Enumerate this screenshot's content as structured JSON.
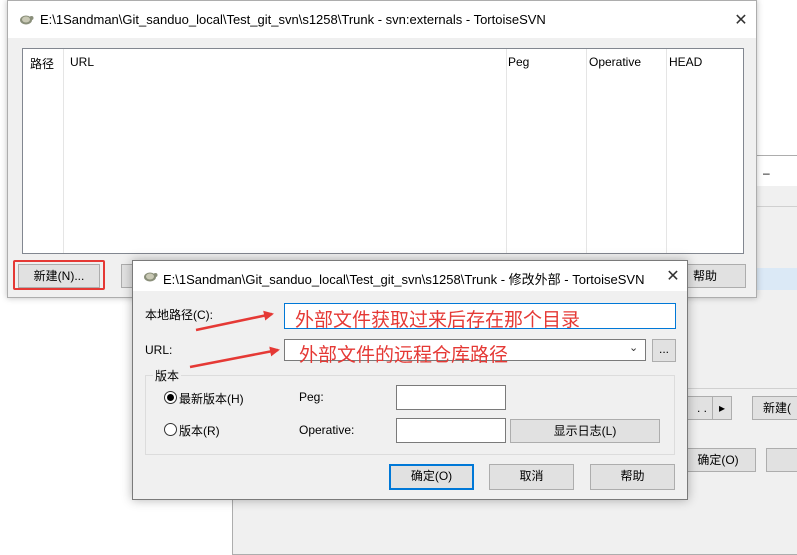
{
  "main_window": {
    "title": "E:\\1Sandman\\Git_sanduo_local\\Test_git_svn\\s1258\\Trunk - svn:externals - TortoiseSVN",
    "columns": [
      "路径",
      "URL",
      "Peg",
      "Operative",
      "HEAD"
    ],
    "buttons": {
      "new": "新建(N)...",
      "help": "帮助"
    }
  },
  "background_window": {
    "title_fragment": "–",
    "buttons": {
      "dots": ". .",
      "next": "▸",
      "new": "新建(",
      "ok": "确定(O)"
    }
  },
  "dialog": {
    "title": "E:\\1Sandman\\Git_sanduo_local\\Test_git_svn\\s1258\\Trunk - 修改外部 - TortoiseSVN",
    "local_path_label": "本地路径(C):",
    "local_path_value": "",
    "url_label": "URL:",
    "url_value": "",
    "browse_button": "...",
    "revision_group": "版本",
    "latest_revision_label": "最新版本(H)",
    "revision_label": "版本(R)",
    "peg_label": "Peg:",
    "peg_value": "",
    "operative_label": "Operative:",
    "operative_value": "",
    "show_log_button": "显示日志(L)",
    "ok_button": "确定(O)",
    "cancel_button": "取消",
    "help_button": "帮助",
    "selected_revision": "latest"
  },
  "annotations": {
    "local_path_note": "外部文件获取过来后存在那个目录",
    "url_note": "外部文件的远程仓库路径",
    "color": "#e53935"
  }
}
